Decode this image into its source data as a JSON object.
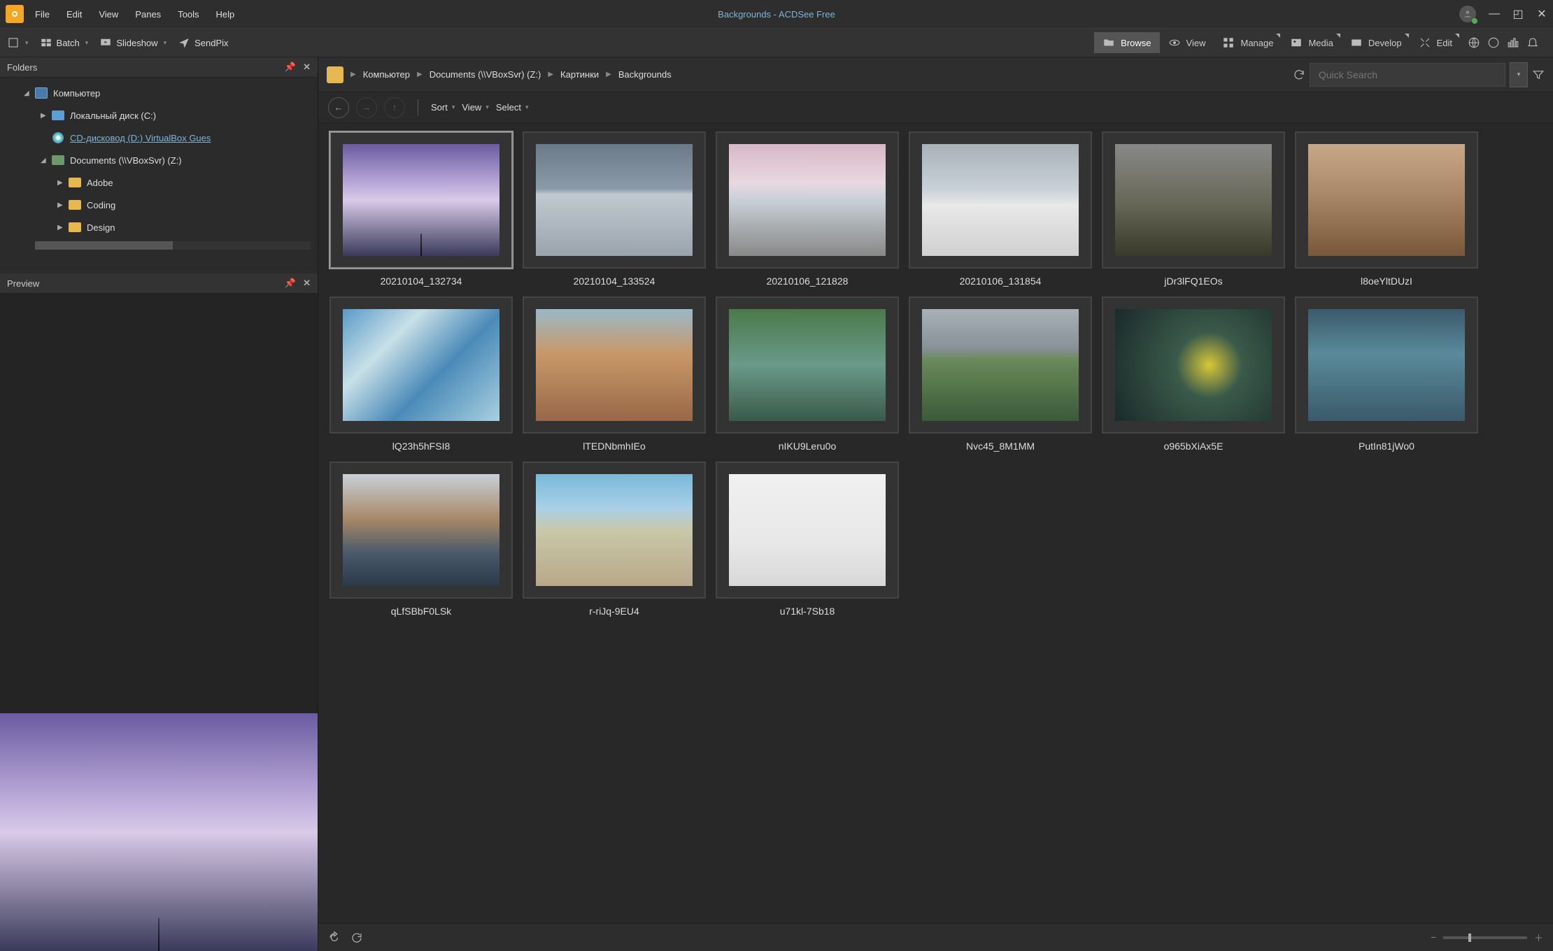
{
  "window": {
    "title": "Backgrounds - ACDSee Free"
  },
  "menu": {
    "file": "File",
    "edit": "Edit",
    "view": "View",
    "panes": "Panes",
    "tools": "Tools",
    "help": "Help"
  },
  "toolbar": {
    "batch": "Batch",
    "slideshow": "Slideshow",
    "sendpix": "SendPix"
  },
  "modes": {
    "browse": "Browse",
    "view": "View",
    "manage": "Manage",
    "media": "Media",
    "develop": "Develop",
    "edit": "Edit"
  },
  "panels": {
    "folders": "Folders",
    "preview": "Preview"
  },
  "tree": {
    "computer": "Компьютер",
    "local_disk": "Локальный диск (C:)",
    "cd": "CD-дисковод (D:) VirtualBox Gues",
    "documents": "Documents (\\\\VBoxSvr) (Z:)",
    "adobe": "Adobe",
    "coding": "Coding",
    "design": "Design"
  },
  "breadcrumb": {
    "computer": "Компьютер",
    "docs": "Documents (\\\\VBoxSvr) (Z:)",
    "pics": "Картинки",
    "bg": "Backgrounds",
    "search_placeholder": "Quick Search"
  },
  "actionbar": {
    "sort": "Sort",
    "view": "View",
    "select": "Select"
  },
  "thumbs": [
    {
      "name": "20210104_132734",
      "cls": "sky-road",
      "selected": true
    },
    {
      "name": "20210104_133524",
      "cls": "snowy-trees"
    },
    {
      "name": "20210106_121828",
      "cls": "highway-pink"
    },
    {
      "name": "20210106_131854",
      "cls": "snow-field"
    },
    {
      "name": "jDr3lFQ1EOs",
      "cls": "fog-forest"
    },
    {
      "name": "l8oeYltDUzI",
      "cls": "mars"
    },
    {
      "name": "lQ23h5hFSI8",
      "cls": "ice-aerial"
    },
    {
      "name": "lTEDNbmhIEo",
      "cls": "canyon"
    },
    {
      "name": "nIKU9Leru0o",
      "cls": "lake-person"
    },
    {
      "name": "Nvc45_8M1MM",
      "cls": "green-hills"
    },
    {
      "name": "o965bXiAx5E",
      "cls": "warehouse"
    },
    {
      "name": "PutIn81jWo0",
      "cls": "foggy-road"
    },
    {
      "name": "qLfSBbF0LSk",
      "cls": "frost-lake"
    },
    {
      "name": "r-riJq-9EU4",
      "cls": "prairie"
    },
    {
      "name": "u71kl-7Sb18",
      "cls": "white-out"
    }
  ]
}
